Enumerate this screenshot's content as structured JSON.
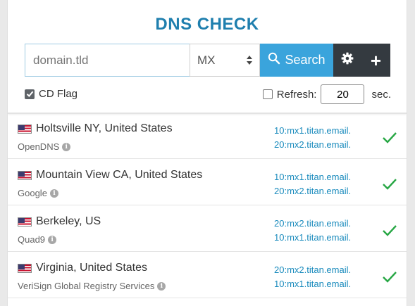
{
  "header": {
    "title": "DNS CHECK"
  },
  "search": {
    "domain_placeholder": "domain.tld",
    "record_type": "MX",
    "search_label": "Search",
    "plus_label": "+"
  },
  "options": {
    "cd_flag_label": "CD Flag",
    "cd_flag_checked": true,
    "refresh_label": "Refresh:",
    "refresh_value": "20",
    "refresh_unit": "sec.",
    "refresh_checked": false
  },
  "results": [
    {
      "location": "Holtsville NY, United States",
      "provider": "OpenDNS",
      "records": [
        "10:mx1.titan.email.",
        "20:mx2.titan.email."
      ],
      "status": "ok"
    },
    {
      "location": "Mountain View CA, United States",
      "provider": "Google",
      "records": [
        "10:mx1.titan.email.",
        "20:mx2.titan.email."
      ],
      "status": "ok"
    },
    {
      "location": "Berkeley, US",
      "provider": "Quad9",
      "records": [
        "20:mx2.titan.email.",
        "10:mx1.titan.email."
      ],
      "status": "ok"
    },
    {
      "location": "Virginia, United States",
      "provider": "VeriSign Global Registry Services",
      "records": [
        "20:mx2.titan.email.",
        "10:mx1.titan.email."
      ],
      "status": "ok"
    }
  ],
  "colors": {
    "accent": "#3aa4dc",
    "title": "#1f7fae",
    "record_text": "#1a8bbd",
    "success": "#28a745",
    "dark_button": "#343a40"
  },
  "icons": {
    "flag": "us-flag-icon",
    "info": "info-icon",
    "check": "check-icon",
    "search": "search-icon",
    "gear": "gear-icon"
  }
}
